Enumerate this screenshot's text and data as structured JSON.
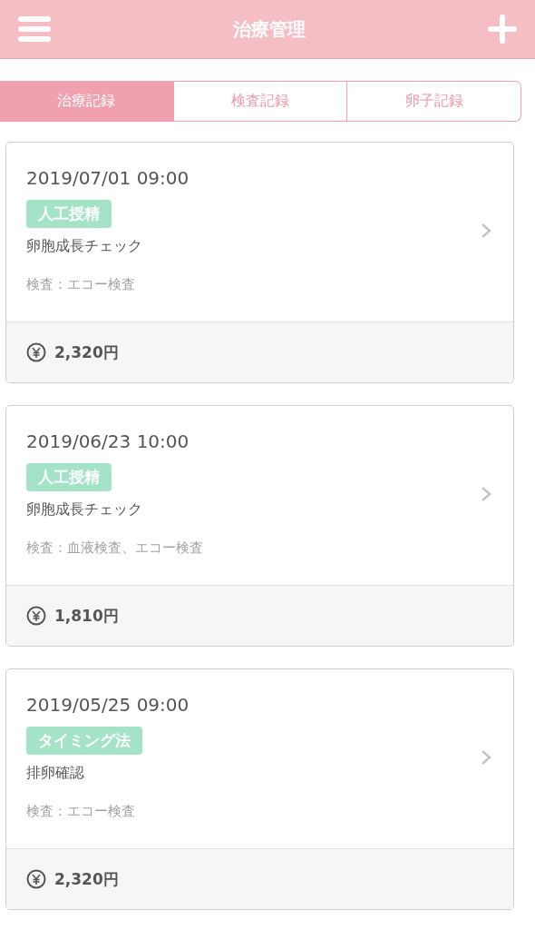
{
  "header": {
    "title": "治療管理"
  },
  "tabs": [
    {
      "label": "治療記録",
      "selected": true
    },
    {
      "label": "検査記録",
      "selected": false
    },
    {
      "label": "卵子記録",
      "selected": false
    }
  ],
  "records": [
    {
      "datetime": "2019/07/01 09:00",
      "tag": "人工授精",
      "title": "卵胞成長チェック",
      "tests": "検査：エコー検査",
      "cost": "2,320円"
    },
    {
      "datetime": "2019/06/23 10:00",
      "tag": "人工授精",
      "title": "卵胞成長チェック",
      "tests": "検査：血液検査、エコー検査",
      "cost": "1,810円"
    },
    {
      "datetime": "2019/05/25 09:00",
      "tag": "タイミング法",
      "title": "排卵確認",
      "tests": "検査：エコー検査",
      "cost": "2,320円"
    }
  ]
}
